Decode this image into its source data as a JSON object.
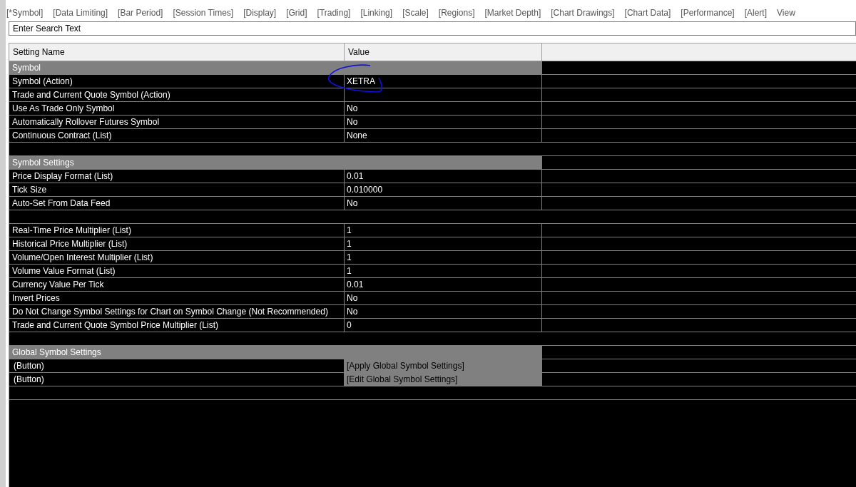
{
  "tabs": [
    "[*Symbol]",
    "[Data Limiting]",
    "[Bar Period]",
    "[Session Times]",
    "[Display]",
    "[Grid]",
    "[Trading]",
    "[Linking]",
    "[Scale]",
    "[Regions]",
    "[Market Depth]",
    "[Chart Drawings]",
    "[Chart Data]",
    "[Performance]",
    "[Alert]",
    "View"
  ],
  "search": {
    "placeholder": "Enter Search Text"
  },
  "table": {
    "columns": [
      "Setting Name",
      "Value"
    ],
    "rows": [
      {
        "kind": "section",
        "name": "Symbol"
      },
      {
        "kind": "setting",
        "name": "Symbol (Action)",
        "value": "XETRA",
        "circled": true
      },
      {
        "kind": "setting",
        "name": "Trade and Current Quote Symbol (Action)",
        "value": ""
      },
      {
        "kind": "setting",
        "name": "Use As Trade Only Symbol",
        "value": "No"
      },
      {
        "kind": "setting",
        "name": "Automatically Rollover Futures Symbol",
        "value": "No"
      },
      {
        "kind": "setting",
        "name": "Continuous Contract (List)",
        "value": "None"
      },
      {
        "kind": "blank"
      },
      {
        "kind": "section",
        "name": "Symbol Settings"
      },
      {
        "kind": "setting",
        "name": "Price Display Format (List)",
        "value": "0.01"
      },
      {
        "kind": "setting",
        "name": "Tick Size",
        "value": "0.010000"
      },
      {
        "kind": "setting",
        "name": "Auto-Set From Data Feed",
        "value": "No"
      },
      {
        "kind": "blank"
      },
      {
        "kind": "setting",
        "name": "Real-Time Price Multiplier (List)",
        "value": "1"
      },
      {
        "kind": "setting",
        "name": "Historical Price Multiplier (List)",
        "value": "1"
      },
      {
        "kind": "setting",
        "name": "Volume/Open Interest Multiplier (List)",
        "value": "1"
      },
      {
        "kind": "setting",
        "name": "Volume Value Format (List)",
        "value": "1"
      },
      {
        "kind": "setting",
        "name": "Currency Value Per Tick",
        "value": "0.01"
      },
      {
        "kind": "setting",
        "name": "Invert Prices",
        "value": "No"
      },
      {
        "kind": "setting",
        "name": "Do Not Change Symbol Settings for Chart on Symbol Change (Not Recommended)",
        "value": "No"
      },
      {
        "kind": "setting",
        "name": "Trade and Current Quote Symbol Price Multiplier (List)",
        "value": "0"
      },
      {
        "kind": "blank"
      },
      {
        "kind": "section",
        "name": "Global Symbol Settings"
      },
      {
        "kind": "button",
        "name": "(Button)",
        "value": "[Apply Global Symbol Settings]"
      },
      {
        "kind": "button",
        "name": "(Button)",
        "value": "[Edit Global Symbol Settings]"
      },
      {
        "kind": "blank"
      }
    ]
  }
}
